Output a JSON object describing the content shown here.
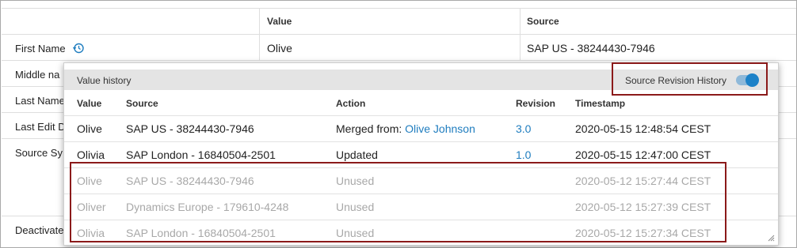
{
  "background_table": {
    "columns": [
      "Value",
      "Source"
    ],
    "rows": [
      {
        "label": "First Name",
        "value": "Olive",
        "source": "SAP US - 38244430-7946"
      },
      {
        "label": "Middle na"
      },
      {
        "label": "Last Name"
      },
      {
        "label": "Last Edit D"
      },
      {
        "label": "Source Sy"
      },
      {
        "label": "Deactivate"
      }
    ]
  },
  "popup": {
    "title": "Value history",
    "toggle_label": "Source Revision History",
    "toggle_on": true,
    "columns": {
      "value": "Value",
      "source": "Source",
      "action": "Action",
      "revision": "Revision",
      "timestamp": "Timestamp"
    },
    "rows": [
      {
        "value": "Olive",
        "source": "SAP US - 38244430-7946",
        "action": "Merged from: ",
        "action_link": "Olive Johnson",
        "revision": "3.0",
        "timestamp": "2020-05-15 12:48:54 CEST"
      },
      {
        "value": "Olivia",
        "source": "SAP London - 16840504-2501",
        "action": "Updated",
        "action_link": "",
        "revision": "1.0",
        "timestamp": "2020-05-15 12:47:00 CEST"
      },
      {
        "value": "Olive",
        "source": "SAP US - 38244430-7946",
        "action": "Unused",
        "action_link": "",
        "revision": "",
        "timestamp": "2020-05-12 15:27:44 CEST"
      },
      {
        "value": "Oliver",
        "source": "Dynamics Europe - 179610-4248",
        "action": "Unused",
        "action_link": "",
        "revision": "",
        "timestamp": "2020-05-12 15:27:39 CEST"
      },
      {
        "value": "Olivia",
        "source": "SAP London - 16840504-2501",
        "action": "Unused",
        "action_link": "",
        "revision": "",
        "timestamp": "2020-05-12 15:27:34 CEST"
      }
    ]
  },
  "colors": {
    "accent": "#1f7dbf",
    "highlight": "#8b1a1a",
    "unused_text": "#a8a8a8",
    "toggle": "#1d82c8"
  },
  "icons": {
    "history": "history-icon",
    "resize": "resize-grip-icon"
  }
}
